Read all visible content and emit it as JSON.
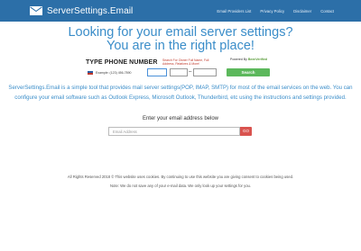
{
  "navbar": {
    "brand": "ServerSettings.Email",
    "links": [
      "Email Providers List",
      "Privacy Policy",
      "Disclaimer",
      "Contact"
    ]
  },
  "headline": {
    "line1": "Looking for your email server settings?",
    "line2": "You are in the right place!"
  },
  "phone_widget": {
    "title": "TYPE PHONE NUMBER",
    "hint": "Search For Owner Full Name, Full Address, Relatives & More!",
    "powered_prefix": "Powered By",
    "powered_brand": "BeenVerified",
    "example": "Example: (123) 456-7890",
    "separator": "–",
    "search_label": "Search"
  },
  "description": "ServerSettings.Email is a simple tool that provides mail server settings(POP, IMAP, SMTP) for most of the email services on the web. You can configure your email software such as Outlook Express, Microsoft Outlook, Thunderbird, etc using the instructions and settings provided.",
  "email_form": {
    "label": "Enter your email address below",
    "placeholder": "Email Address",
    "button_label": "GO"
  },
  "footer": {
    "line1": "All Rights Reserved 2018 © This website uses cookies. By continuing to use this website you are giving consent to cookies being used.",
    "line2": "Note: We do not save any of your e-mail data. We only look up your settings for you."
  },
  "colors": {
    "navbar": "#2c6fa8",
    "accent": "#3a8dc9",
    "search_button": "#5cb85c",
    "go_button": "#d9534f"
  }
}
